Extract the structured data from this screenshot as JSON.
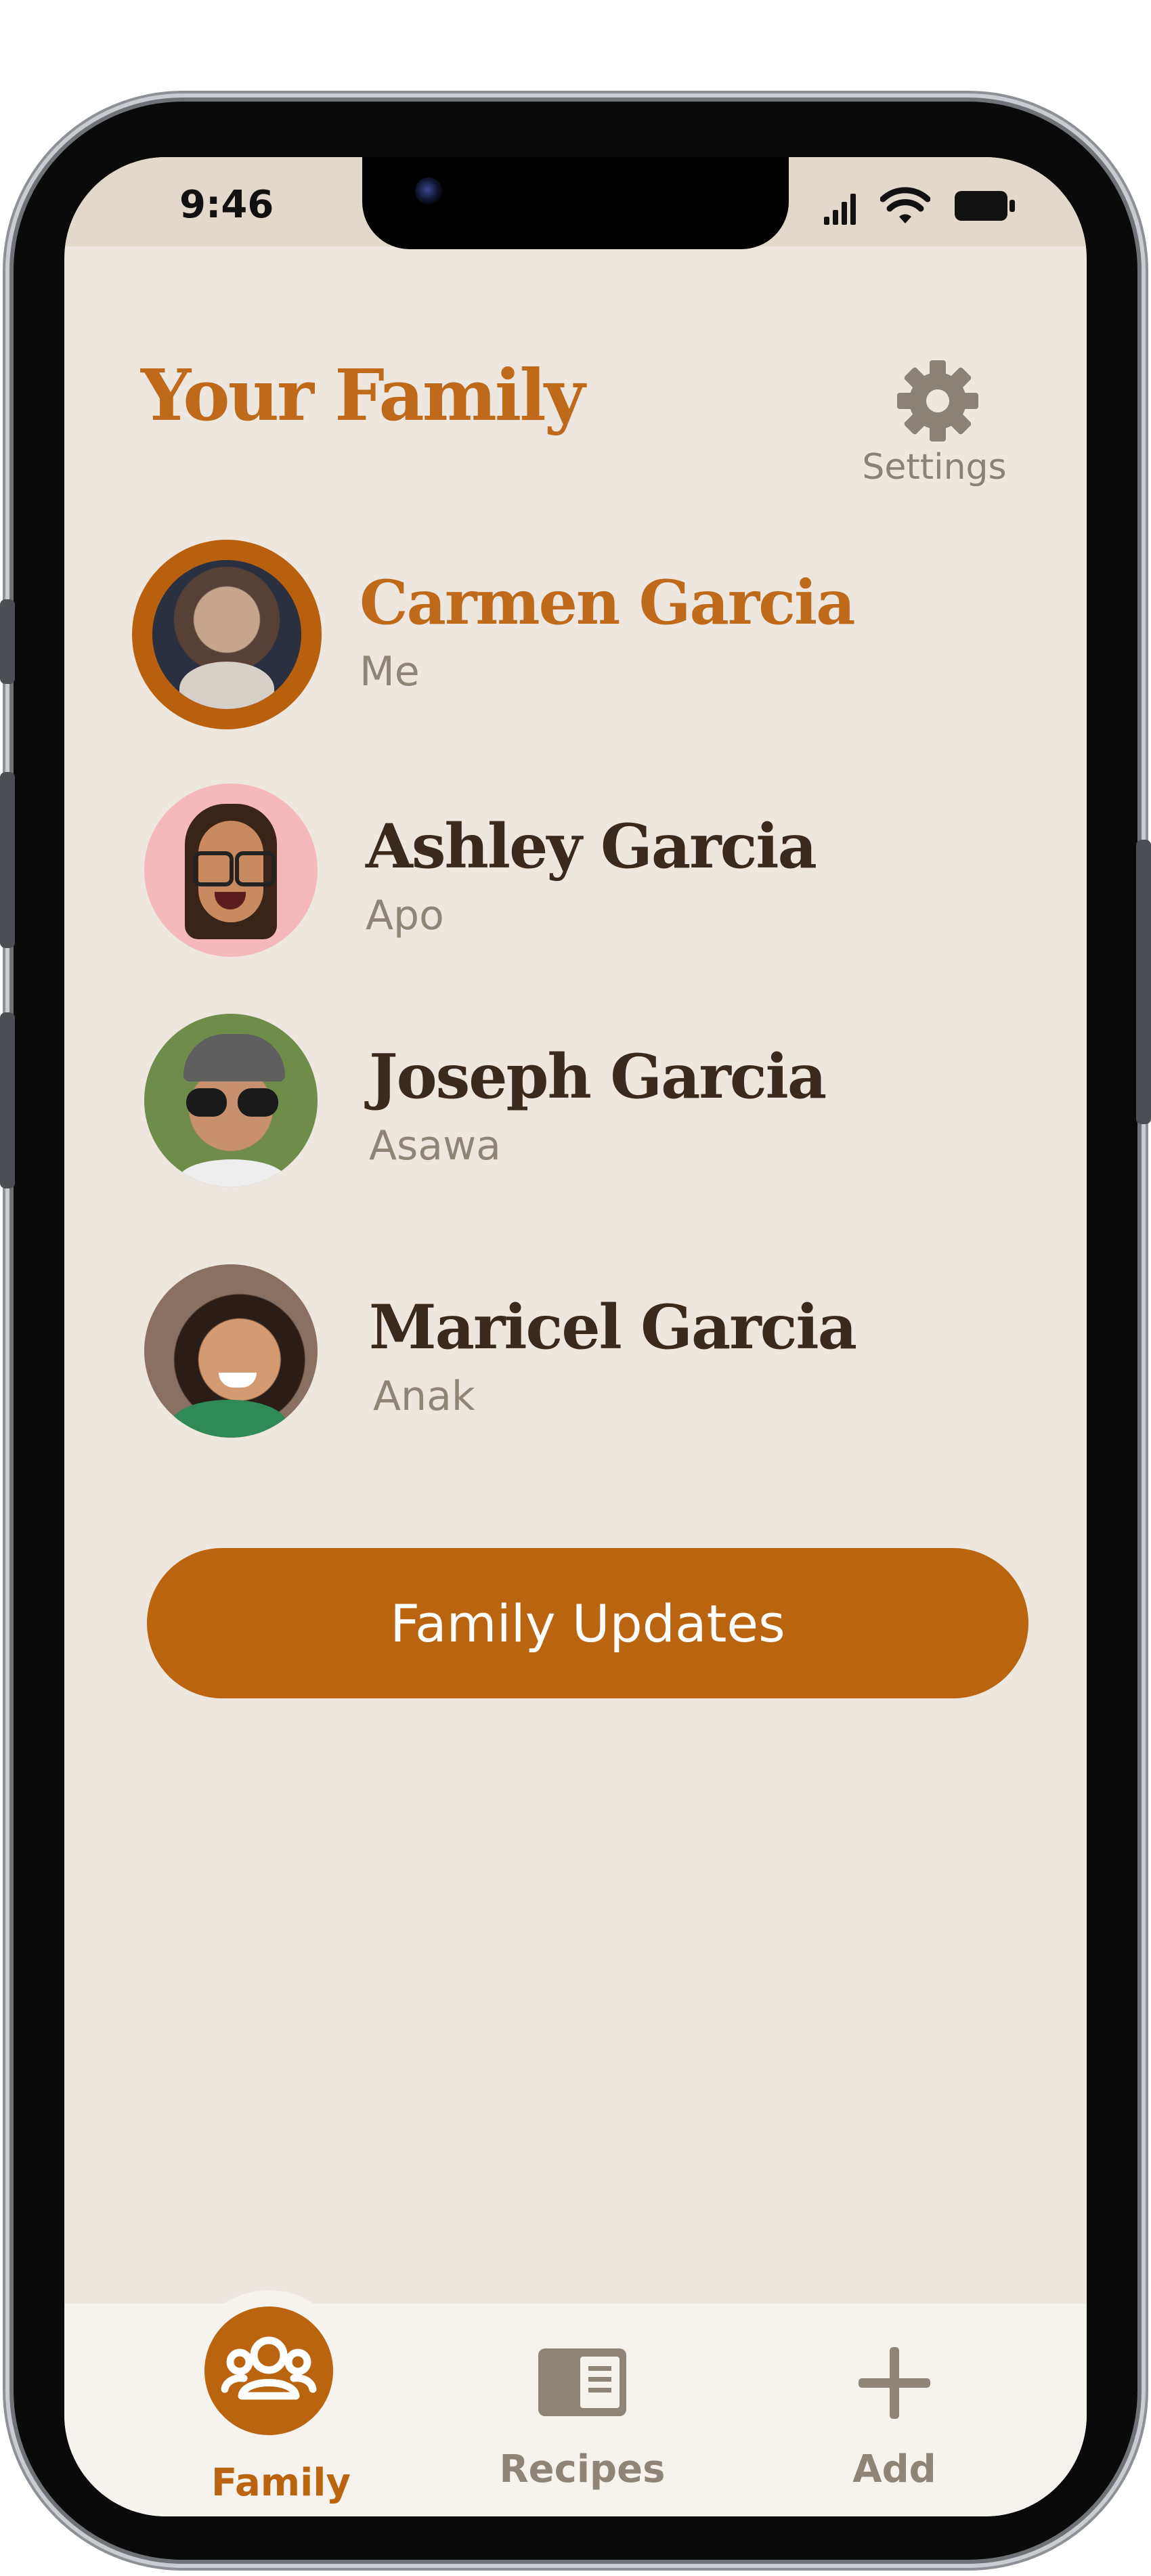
{
  "status_bar": {
    "time": "9:46"
  },
  "header": {
    "title": "Your Family",
    "settings_label": "Settings"
  },
  "members": [
    {
      "name": "Carmen Garcia",
      "relation": "Me",
      "active": true
    },
    {
      "name": "Ashley Garcia",
      "relation": "Apo",
      "active": false
    },
    {
      "name": "Joseph Garcia",
      "relation": "Asawa",
      "active": false
    },
    {
      "name": "Maricel Garcia",
      "relation": "Anak",
      "active": false
    }
  ],
  "family_updates_label": "Family Updates",
  "tabs": [
    {
      "label": "Family",
      "icon": "people-icon",
      "active": true
    },
    {
      "label": "Recipes",
      "icon": "book-icon",
      "active": false
    },
    {
      "label": "Add",
      "icon": "plus-icon",
      "active": false
    }
  ],
  "colors": {
    "accent": "#bb640f",
    "title": "#bf6a1a",
    "background": "#ede7df",
    "text": "#3a2a1e",
    "muted": "#8e8578"
  }
}
